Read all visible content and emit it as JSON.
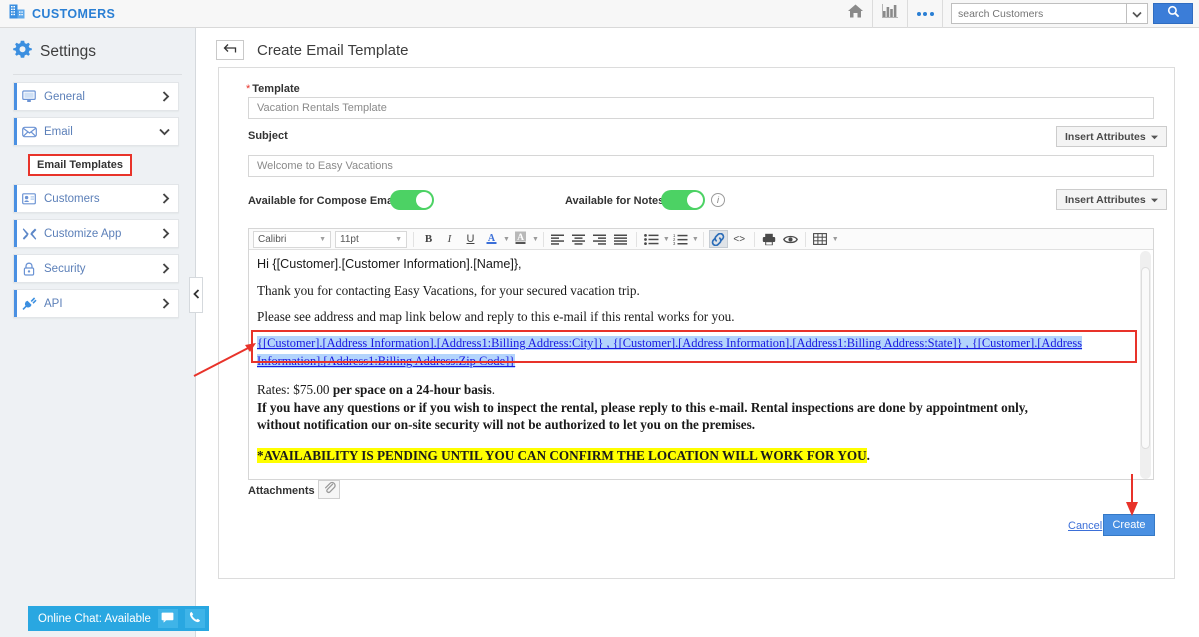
{
  "topbar": {
    "brand": "CUSTOMERS",
    "brand_icon": "building-icon",
    "home_icon": "home-icon",
    "reports_icon": "bar-chart-icon",
    "more_icon": "more-dots-icon",
    "search_placeholder": "search Customers",
    "search_value": "",
    "search_caret_icon": "chevron-down-icon",
    "search_button_icon": "search-icon"
  },
  "sidebar": {
    "title": "Settings",
    "title_icon": "gear-icon",
    "items": [
      {
        "label": "General",
        "icon": "monitor-icon",
        "chevron": "chevron-right-icon"
      },
      {
        "label": "Email",
        "icon": "envelope-icon",
        "chevron": "chevron-down-icon"
      },
      {
        "label": "Customers",
        "icon": "contact-card-icon",
        "chevron": "chevron-right-icon"
      },
      {
        "label": "Customize App",
        "icon": "wrench-icon",
        "chevron": "chevron-right-icon"
      },
      {
        "label": "Security",
        "icon": "lock-icon",
        "chevron": "chevron-right-icon"
      },
      {
        "label": "API",
        "icon": "plug-icon",
        "chevron": "chevron-right-icon"
      }
    ],
    "sub_item": "Email Templates",
    "collapse_icon": "chevron-left-icon"
  },
  "page": {
    "title": "Create Email Template",
    "back_icon": "back-arrow-icon"
  },
  "form": {
    "template_label": "Template",
    "template_required": "*",
    "template_value": "Vacation Rentals Template",
    "subject_label": "Subject",
    "subject_value": "Welcome to Easy Vacations",
    "insert_attributes_1": "Insert Attributes",
    "insert_attributes_2": "Insert Attributes",
    "dropdown_caret": "caret-down-icon",
    "compose_label": "Available for Compose Email?",
    "compose_toggle": "on",
    "notes_label": "Available for Notes?",
    "notes_toggle": "on",
    "notes_info_icon": "info-icon",
    "attachments_label": "Attachments",
    "attachment_icon": "paperclip-icon",
    "cancel_label": "Cancel",
    "create_label": "Create"
  },
  "editor": {
    "font_family": "Calibri",
    "font_size": "11pt",
    "buttons": [
      {
        "name": "bold-button",
        "glyph": "B"
      },
      {
        "name": "italic-button",
        "glyph": "I"
      },
      {
        "name": "underline-button",
        "glyph": "U"
      },
      {
        "name": "text-color-button",
        "glyph": "A"
      },
      {
        "name": "highlight-button",
        "glyph": "A"
      },
      {
        "name": "align-left-button",
        "glyph": ""
      },
      {
        "name": "align-center-button",
        "glyph": ""
      },
      {
        "name": "align-right-button",
        "glyph": ""
      },
      {
        "name": "align-justify-button",
        "glyph": ""
      },
      {
        "name": "bullet-list-button",
        "glyph": ""
      },
      {
        "name": "numbered-list-button",
        "glyph": ""
      },
      {
        "name": "link-button",
        "glyph": ""
      },
      {
        "name": "source-code-button",
        "glyph": "<>"
      },
      {
        "name": "print-button",
        "glyph": ""
      },
      {
        "name": "preview-button",
        "glyph": ""
      },
      {
        "name": "table-button",
        "glyph": ""
      }
    ],
    "content": {
      "greeting": "Hi {[Customer].[Customer Information].[Name]},",
      "para1": "Thank you for contacting Easy Vacations, for your secured vacation trip.",
      "para2": "Please see address and map link below and reply to this e-mail if this rental works for you.",
      "address_link": "{[Customer].[Address Information].[Address1:Billing Address:City]} , {[Customer].[Address Information].[Address1:Billing Address:State]} , {[Customer].[Address Information].[Address1:Billing Address:Zip Code]}",
      "rates_prefix": "Rates: $75.00 ",
      "rates_bold": "per space on a 24-hour basis",
      "rates_suffix": ".",
      "policy_line1": "If you have any questions or if you wish to inspect the rental, please reply to this e-mail. Rental inspections are done by appointment only,",
      "policy_line2": "without notification our on-site security will not be authorized to let you on the premises.",
      "availability": "*AVAILABILITY IS PENDING UNTIL YOU CAN CONFIRM THE LOCATION WILL WORK FOR YOU",
      "availability_suffix": "."
    }
  },
  "chat": {
    "label": "Online Chat: Available",
    "message_icon": "chat-bubble-icon",
    "phone_icon": "phone-icon"
  },
  "colors": {
    "brand_blue": "#2a7fd4",
    "accent_blue": "#4a90e2",
    "toggle_green": "#4cd264",
    "annotation_red": "#e8332a",
    "highlight_yellow": "#ffff00",
    "chat_blue": "#29a7e1"
  }
}
